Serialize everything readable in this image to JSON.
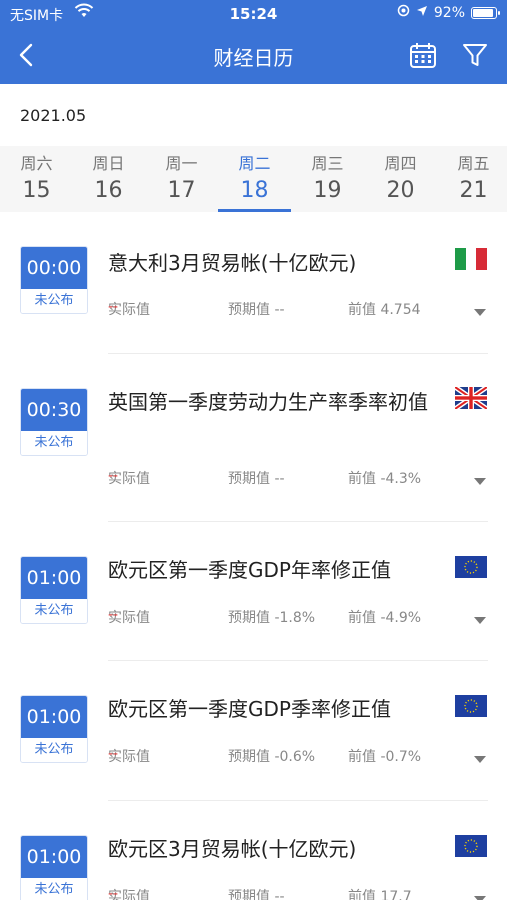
{
  "status": {
    "carrier": "无SIM卡",
    "time": "15:24",
    "battery": "92%"
  },
  "nav": {
    "title": "财经日历",
    "icons": [
      "back-icon",
      "calendar-icon",
      "filter-icon"
    ]
  },
  "date_picker": {
    "month": "2021.05",
    "days": [
      {
        "weekday": "周六",
        "date": "15"
      },
      {
        "weekday": "周日",
        "date": "16"
      },
      {
        "weekday": "周一",
        "date": "17"
      },
      {
        "weekday": "周二",
        "date": "18",
        "selected": true
      },
      {
        "weekday": "周三",
        "date": "19"
      },
      {
        "weekday": "周四",
        "date": "20"
      },
      {
        "weekday": "周五",
        "date": "21"
      }
    ]
  },
  "events": [
    {
      "time": "00:00",
      "status": "未公布",
      "title": "意大利3月贸易帐(十亿欧元)",
      "flag": "italy-flag",
      "actual_label": "实际值",
      "actual_value": "--",
      "forecast": "预期值 --",
      "previous": "前值 4.754"
    },
    {
      "time": "00:30",
      "status": "未公布",
      "title": "英国第一季度劳动力生产率季率初值",
      "flag": "uk-flag",
      "actual_label": "实际值",
      "actual_value": "--",
      "forecast": "预期值 --",
      "previous": "前值 -4.3%"
    },
    {
      "time": "01:00",
      "status": "未公布",
      "title": "欧元区第一季度GDP年率修正值",
      "flag": "eu-flag",
      "actual_label": "实际值",
      "actual_value": "--",
      "forecast": "预期值 -1.8%",
      "previous": "前值 -4.9%"
    },
    {
      "time": "01:00",
      "status": "未公布",
      "title": "欧元区第一季度GDP季率修正值",
      "flag": "eu-flag",
      "actual_label": "实际值",
      "actual_value": "--",
      "forecast": "预期值 -0.6%",
      "previous": "前值 -0.7%"
    },
    {
      "time": "01:00",
      "status": "未公布",
      "title": "欧元区3月贸易帐(十亿欧元)",
      "flag": "eu-flag",
      "actual_label": "实际值",
      "actual_value": "--",
      "forecast": "预期值 --",
      "previous": "前值 17.7"
    }
  ],
  "colors": {
    "primary": "#3a73d6",
    "actual_dash": "#e03a3a"
  }
}
